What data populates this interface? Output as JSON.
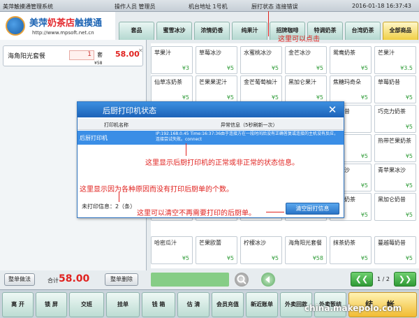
{
  "topbar": {
    "app_name": "美萍触摸通管理系统",
    "operator": "操作人员 管理员",
    "terminal": "机台地址 1号机",
    "kitchen_status": "厨打状态 连接错误",
    "datetime": "2016-01-18 16:37:43"
  },
  "logo": {
    "brand_a": "美萍",
    "brand_b": "奶茶店",
    "brand_c": "触摸通",
    "url": "http://www.mpsoft.net.cn"
  },
  "tabs": [
    "套品",
    "蜜雪冰沙",
    "浓情奶香",
    "纯果汁",
    "招牌咖啡",
    "特调奶茶",
    "台湾奶茶",
    "全部商品"
  ],
  "order": {
    "item_name": "海角阳光套餐",
    "qty": "1",
    "unit": "套",
    "price": "58.00",
    "subtotal": "¥58",
    "close": "✕"
  },
  "grid": [
    [
      {
        "n": "苹果汁",
        "p": "¥3"
      },
      {
        "n": "草莓冰沙",
        "p": "¥5"
      },
      {
        "n": "水蜜桃冰沙",
        "p": "¥5"
      },
      {
        "n": "金芒冰沙",
        "p": "¥5"
      },
      {
        "n": "鸳鸯奶茶",
        "p": "¥5"
      },
      {
        "n": "芒果汁",
        "p": "¥3.5"
      }
    ],
    [
      {
        "n": "仙草冻奶茶",
        "p": "¥5"
      },
      {
        "n": "芒果果泥汁",
        "p": "¥5"
      },
      {
        "n": "金芒葡萄柚汁",
        "p": "¥5"
      },
      {
        "n": "黑加仑果汁",
        "p": "¥5"
      },
      {
        "n": "焦糖玛奇朵",
        "p": "¥5"
      },
      {
        "n": "草莓奶昔",
        "p": "¥5"
      }
    ],
    [
      {
        "n": "",
        "p": ""
      },
      {
        "n": "",
        "p": ""
      },
      {
        "n": "",
        "p": ""
      },
      {
        "n": "",
        "p": ""
      },
      {
        "n": "桃奶昔",
        "p": ""
      },
      {
        "n": "巧克力奶茶",
        "p": "¥5"
      }
    ],
    [
      {
        "n": "",
        "p": ""
      },
      {
        "n": "",
        "p": ""
      },
      {
        "n": "",
        "p": ""
      },
      {
        "n": "",
        "p": ""
      },
      {
        "n": "咖啡",
        "p": "¥5"
      },
      {
        "n": "热带芒果奶茶",
        "p": "¥5"
      }
    ],
    [
      {
        "n": "",
        "p": ""
      },
      {
        "n": "",
        "p": ""
      },
      {
        "n": "",
        "p": ""
      },
      {
        "n": "",
        "p": ""
      },
      {
        "n": "仑冰沙",
        "p": "¥5"
      },
      {
        "n": "青苹果冰沙",
        "p": "¥5"
      }
    ],
    [
      {
        "n": "",
        "p": "¥5"
      },
      {
        "n": "",
        "p": "¥5"
      },
      {
        "n": "",
        "p": "¥5"
      },
      {
        "n": "",
        "p": "¥5"
      },
      {
        "n": "布诺奶茶",
        "p": "¥5"
      },
      {
        "n": "黑加仑奶昔",
        "p": "¥5"
      }
    ],
    [
      {
        "n": "哈密瓜汁",
        "p": "¥5"
      },
      {
        "n": "芒果欧蕾",
        "p": "¥5"
      },
      {
        "n": "柠檬冰沙",
        "p": "¥5"
      },
      {
        "n": "海角阳光套餐",
        "p": "¥58"
      },
      {
        "n": "抹茶奶茶",
        "p": "¥5"
      },
      {
        "n": "蔓越莓奶昔",
        "p": "¥5"
      }
    ]
  ],
  "bottom": {
    "merge_btn": "整单做法",
    "total_label": "合计",
    "total_value": "58.00",
    "delete_btn": "整单删除",
    "prev": "❮❮",
    "page": "1 / 2",
    "next": "❯❯"
  },
  "funcbar": [
    "离 开",
    "锁 屏",
    "交班",
    "挂单",
    "钱 箱",
    "估 清",
    "会员充值",
    "新近账单",
    "外卖回款",
    "外卖暂结",
    "结 帐"
  ],
  "dialog": {
    "title": "后厨打印机状态",
    "close": "✕",
    "col_printer": "打印机名称",
    "col_status": "异常信息（5秒刷新一次）",
    "row_printer": "后厨打印机",
    "row_status": "IP:192.168.0.45 Time:16:37:36由于连接方在一段时间后没有正确答复或连接的主机没有反应，连接尝试失败。connect",
    "unprinted_label": "未打印信息：2（条）",
    "clear_btn": "清空厨打信息"
  },
  "annotations": {
    "click": "这里可以点击",
    "status_info": "这里显示后厨打印机的正常或非正常的状态信息。",
    "unprinted": "这里显示因为各种原因而没有打印后厨单的个数。",
    "clear": "这里可以清空不再需要打印的后厨单。"
  },
  "watermark": "china.makepolo.com",
  "colors": {
    "accent_red": "#e0221f",
    "price_green": "#2f9c38",
    "dialog_blue": "#1c62b8",
    "active_tab": "#f0cf45"
  }
}
